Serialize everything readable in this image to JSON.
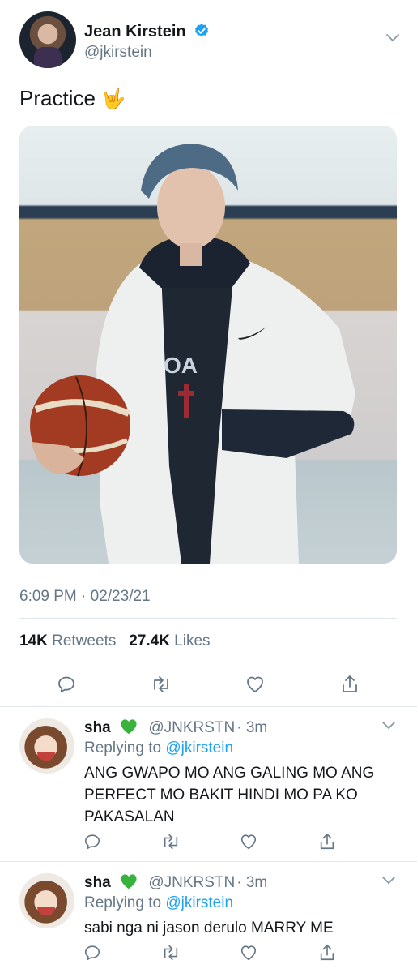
{
  "tweet": {
    "display_name": "Jean Kirstein",
    "handle": "@jkirstein",
    "text": "Practice",
    "emoji": "🤟",
    "timestamp": "6:09 PM · 02/23/21",
    "retweets_count": "14K",
    "retweets_label": "Retweets",
    "likes_count": "27.4K",
    "likes_label": "Likes",
    "accent_color": "#1da1f2",
    "icons": [
      "verified-badge",
      "chevron-down",
      "reply",
      "retweet",
      "like",
      "share"
    ]
  },
  "replies": [
    {
      "name": "sha",
      "emoji": "💚",
      "handle": "@JNKRSTN",
      "time": "· 3m",
      "replying_prefix": "Replying to",
      "replying_to": "@jkirstein",
      "text": "ANG GWAPO MO ANG GALING MO ANG PERFECT MO BAKIT HINDI MO PA KO PAKASALAN"
    },
    {
      "name": "sha",
      "emoji": "💚",
      "handle": "@JNKRSTN",
      "time": "· 3m",
      "replying_prefix": "Replying to",
      "replying_to": "@jkirstein",
      "text": "sabi nga ni jason derulo MARRY ME"
    }
  ]
}
